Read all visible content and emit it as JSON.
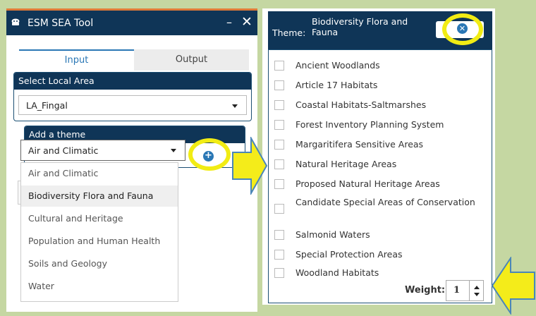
{
  "app": {
    "title": "ESM SEA Tool",
    "minimize": "–",
    "close": "✕"
  },
  "tabs": [
    {
      "label": "Input",
      "active": true
    },
    {
      "label": "Output",
      "active": false
    }
  ],
  "local_area": {
    "header": "Select Local Area",
    "value": "LA_Fingal"
  },
  "theme_picker": {
    "header": "Add a theme",
    "value": "Air and Climatic",
    "options": [
      "Air and Climatic",
      "Biodiversity Flora and Fauna",
      "Cultural and Heritage",
      "Population and Human Health",
      "Soils and Geology",
      "Water"
    ],
    "highlighted_option": "Biodiversity Flora and Fauna"
  },
  "add_button": {
    "glyph": "+"
  },
  "theme_panel": {
    "label": "Theme:",
    "name": "Biodiversity Flora and Fauna",
    "remove_glyph": "✕",
    "layers": [
      "Ancient Woodlands",
      "Article 17 Habitats",
      "Coastal Habitats-Saltmarshes",
      "Forest Inventory Planning System",
      "Margaritifera Sensitive Areas",
      "Natural Heritage Areas",
      "Proposed Natural Heritage Areas",
      "Candidate Special Areas of Conservation",
      "Salmonid Waters",
      "Special Protection Areas",
      "Woodland Habitats"
    ],
    "weight_label": "Weight:",
    "weight_value": "1"
  },
  "colors": {
    "background": "#c5d7a2",
    "header_navy": "#0f3557",
    "accent_blue": "#2a77b5",
    "highlight_yellow": "#f1ec14",
    "arrow_fill": "#f4ec1a",
    "arrow_stroke": "#4a86b9"
  }
}
